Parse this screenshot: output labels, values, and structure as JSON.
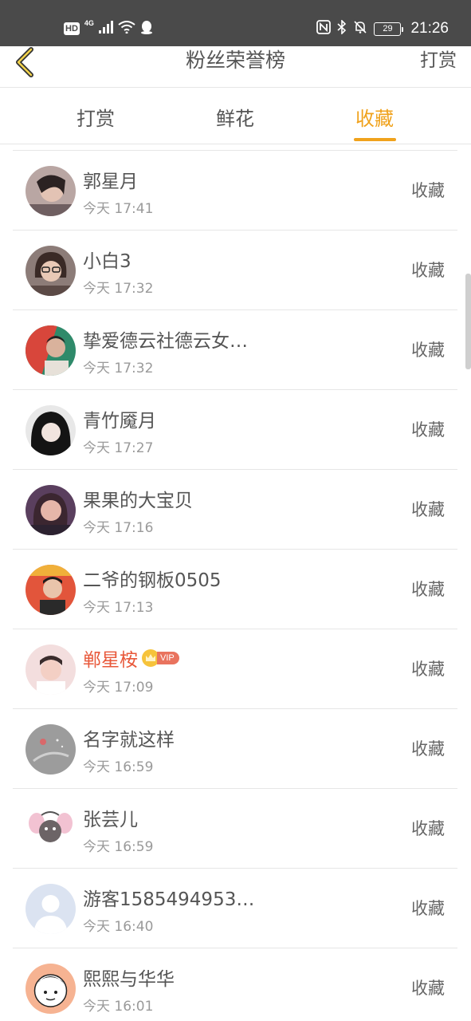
{
  "status_bar": {
    "hd": "HD",
    "network": "4G",
    "battery": "29",
    "time": "21:26"
  },
  "header": {
    "title": "粉丝荣誉榜",
    "action": "打赏"
  },
  "tabs": [
    {
      "label": "打赏",
      "active": false
    },
    {
      "label": "鲜花",
      "active": false
    },
    {
      "label": "收藏",
      "active": true
    }
  ],
  "colors": {
    "accent": "#f0a21c",
    "vip_name": "#e8583a",
    "status_bar": "#4a4a4a"
  },
  "rows": [
    {
      "name": "郭星月",
      "time": "今天 17:41",
      "action": "收藏",
      "avatar": "avatar-photo-icon"
    },
    {
      "name": "小白3",
      "time": "今天 17:32",
      "action": "收藏",
      "avatar": "avatar-photo-icon"
    },
    {
      "name": "挚爱德云社德云女…",
      "time": "今天 17:32",
      "action": "收藏",
      "avatar": "avatar-photo-icon"
    },
    {
      "name": "青竹魇月",
      "time": "今天 17:27",
      "action": "收藏",
      "avatar": "avatar-photo-icon"
    },
    {
      "name": "果果的大宝贝",
      "time": "今天 17:16",
      "action": "收藏",
      "avatar": "avatar-photo-icon"
    },
    {
      "name": "二爷的钢板0505",
      "time": "今天 17:13",
      "action": "收藏",
      "avatar": "avatar-photo-icon"
    },
    {
      "name": "郸星桉",
      "time": "今天 17:09",
      "action": "收藏",
      "avatar": "avatar-photo-icon",
      "vip_label": "VIP"
    },
    {
      "name": "名字就这样",
      "time": "今天 16:59",
      "action": "收藏",
      "avatar": "avatar-photo-icon"
    },
    {
      "name": "张芸儿",
      "time": "今天 16:59",
      "action": "收藏",
      "avatar": "avatar-photo-icon"
    },
    {
      "name": "游客1585494953…",
      "time": "今天 16:40",
      "action": "收藏",
      "avatar": "default-avatar-icon"
    },
    {
      "name": "熙熙与华华",
      "time": "今天 16:01",
      "action": "收藏",
      "avatar": "avatar-photo-icon"
    }
  ]
}
